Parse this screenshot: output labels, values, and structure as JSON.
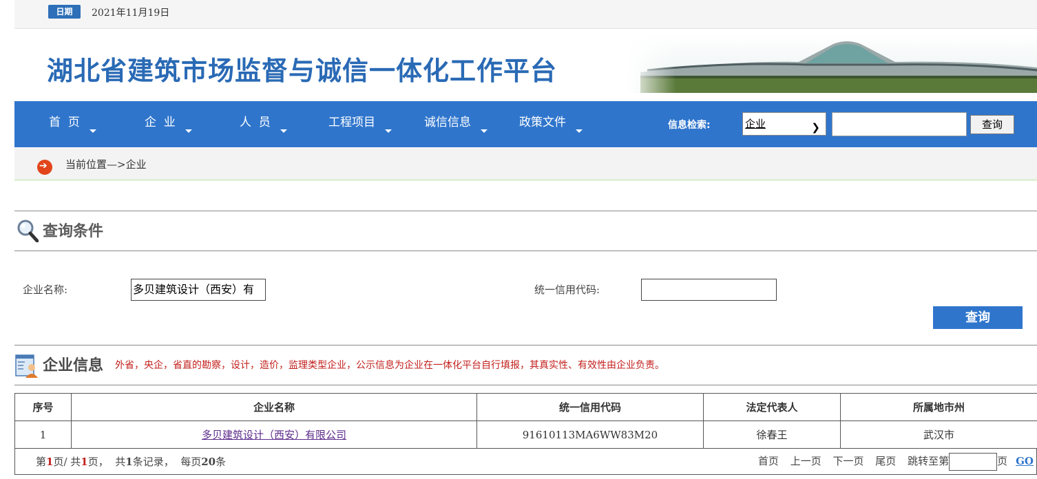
{
  "header": {
    "date_badge": "日期",
    "date_text": "2021年11月19日",
    "site_title": "湖北省建筑市场监督与诚信一体化工作平台"
  },
  "nav": {
    "items": [
      {
        "label": "首  页"
      },
      {
        "label": "企  业"
      },
      {
        "label": "人  员"
      },
      {
        "label": "工程项目"
      },
      {
        "label": "诚信信息"
      },
      {
        "label": "政策文件"
      }
    ],
    "search_label": "信息检索:",
    "search_type": "企业",
    "search_value": "",
    "search_button": "查询"
  },
  "breadcrumb": "当前位置—>企业",
  "query": {
    "title": "查询条件",
    "company_name_label": "企业名称:",
    "company_name_value": "多贝建筑设计（西安）有",
    "credit_code_label": "统一信用代码:",
    "credit_code_value": "",
    "submit_label": "查询"
  },
  "info": {
    "title": "企业信息",
    "note": "外省，央企，省直的勘察，设计，造价，监理类型企业，公示信息为企业在一体化平台自行填报，其真实性、有效性由企业负责。"
  },
  "table": {
    "headers": [
      "序号",
      "企业名称",
      "统一信用代码",
      "法定代表人",
      "所属地市州"
    ],
    "rows": [
      [
        "1",
        "多贝建筑设计（西安）有限公司",
        "91610113MA6WW83M20",
        "徐春王",
        "武汉市"
      ]
    ]
  },
  "pager": {
    "page_prefix": "第",
    "current_page": "1",
    "page_mid": "页/ 共",
    "total_pages": "1",
    "page_suffix": "页，  共",
    "total_records": "1",
    "records_suffix": "条记录，  每页",
    "page_size": "20",
    "size_suffix": "条",
    "first": "首页",
    "prev": "上一页",
    "next": "下一页",
    "last": "尾页",
    "jump_label": "跳转至第",
    "jump_suffix": "页",
    "go": "GO"
  },
  "colors": {
    "nav_blue": "#2f75cc",
    "title_blue": "#2a6ab5",
    "note_red": "#c2201d",
    "link_purple": "#5b2a8a"
  }
}
